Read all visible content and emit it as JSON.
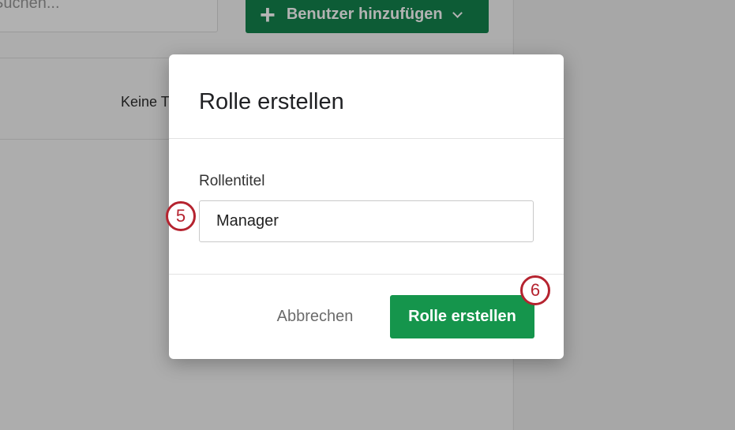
{
  "background": {
    "search_placeholder": "Suchen...",
    "add_user_button": {
      "label": "Benutzer hinzufügen",
      "icon": "plus-icon",
      "dropdown_icon": "chevron-down-icon"
    },
    "panel_text": "Keine T"
  },
  "modal": {
    "title": "Rolle erstellen",
    "field": {
      "label": "Rollentitel",
      "value": "Manager"
    },
    "cancel_label": "Abbrechen",
    "submit_label": "Rolle erstellen"
  },
  "annotations": {
    "step_a": "5",
    "step_b": "6"
  },
  "colors": {
    "overlay": "#a9a9a9",
    "primary_green": "#15954c",
    "step_marker_red": "#b5232f"
  }
}
